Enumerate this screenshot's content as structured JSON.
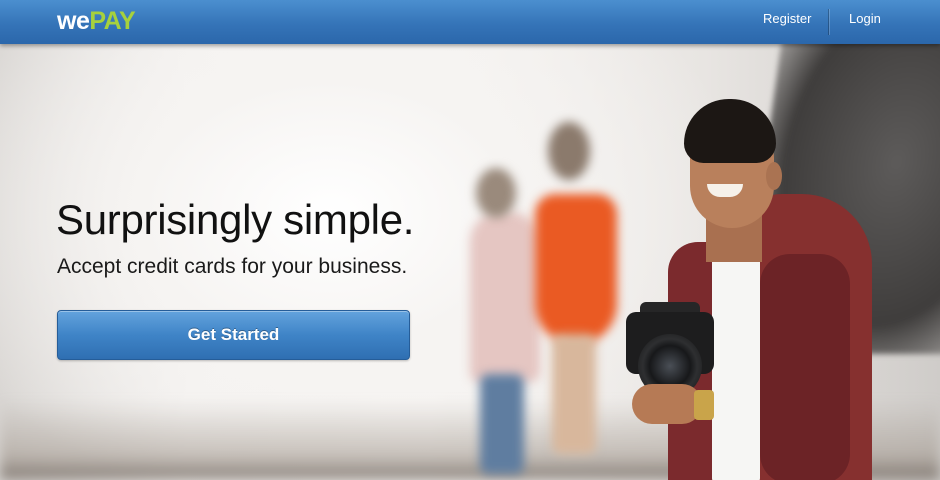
{
  "header": {
    "logo": {
      "part1": "we",
      "part2": "PAY"
    },
    "nav": {
      "register_label": "Register",
      "login_label": "Login"
    }
  },
  "hero": {
    "headline": "Surprisingly simple.",
    "subheadline": "Accept credit cards for your business.",
    "cta_label": "Get Started"
  },
  "colors": {
    "header_blue": "#3574b8",
    "logo_green": "#a6d13d",
    "button_blue": "#3f84c7",
    "cardigan": "#86302f",
    "dress": "#ea5a23"
  }
}
